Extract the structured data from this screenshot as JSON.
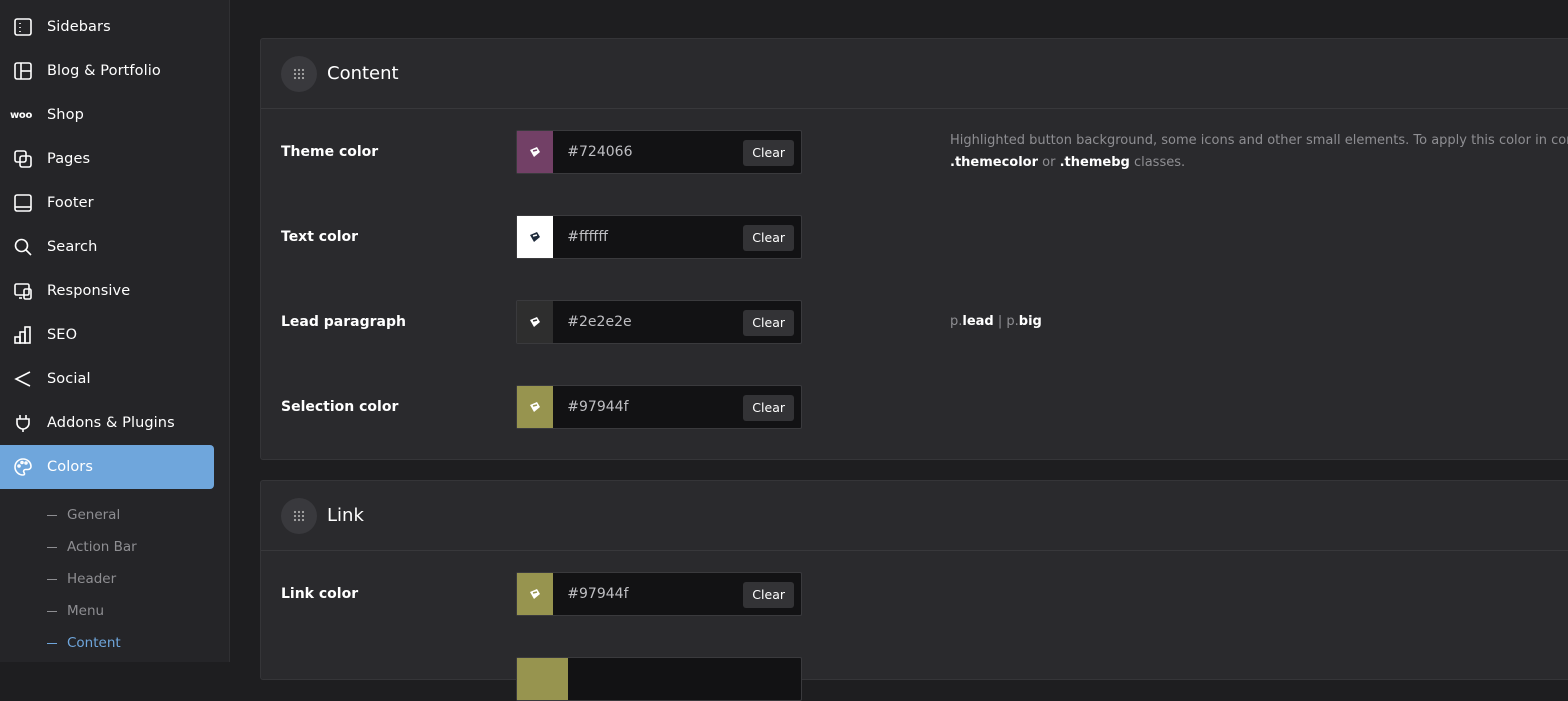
{
  "sidebar": {
    "items": [
      {
        "label": "Sidebars",
        "icon": "sidebar-layout-icon"
      },
      {
        "label": "Blog & Portfolio",
        "icon": "grid-layout-icon"
      },
      {
        "label": "Shop",
        "icon": "woo-icon",
        "icon_text": "woo"
      },
      {
        "label": "Pages",
        "icon": "pages-icon"
      },
      {
        "label": "Footer",
        "icon": "footer-icon"
      },
      {
        "label": "Search",
        "icon": "search-icon"
      },
      {
        "label": "Responsive",
        "icon": "responsive-icon"
      },
      {
        "label": "SEO",
        "icon": "bar-chart-icon"
      },
      {
        "label": "Social",
        "icon": "share-icon"
      },
      {
        "label": "Addons & Plugins",
        "icon": "plug-icon"
      },
      {
        "label": "Colors",
        "icon": "palette-icon",
        "active": true
      }
    ],
    "sub_items": [
      {
        "label": "General"
      },
      {
        "label": "Action Bar"
      },
      {
        "label": "Header"
      },
      {
        "label": "Menu"
      },
      {
        "label": "Content",
        "active": true
      }
    ]
  },
  "content_panel": {
    "title": "Content",
    "rows": [
      {
        "label": "Theme color",
        "value": "#724066",
        "swatch": "#724066",
        "clear": "Clear"
      },
      {
        "label": "Text color",
        "value": "#ffffff",
        "swatch": "#ffffff",
        "clear": "Clear"
      },
      {
        "label": "Lead paragraph",
        "value": "#2e2e2e",
        "swatch": "#2e2e2e",
        "clear": "Clear"
      },
      {
        "label": "Selection color",
        "value": "#97944f",
        "swatch": "#97944f",
        "clear": "Clear"
      }
    ],
    "theme_desc": {
      "line1": "Highlighted button background, some icons and other small elements. To apply this color in cor",
      "class1": ".themecolor",
      "or": " or ",
      "class2": ".themebg",
      "classes": " classes."
    },
    "lead_desc": {
      "p1": "p.",
      "lead": "lead",
      "sep": " | ",
      "p2": "p.",
      "big": "big"
    }
  },
  "link_panel": {
    "title": "Link",
    "rows": [
      {
        "label": "Link color",
        "value": "#97944f",
        "swatch": "#97944f",
        "clear": "Clear"
      },
      {
        "label": "",
        "value": "",
        "swatch": "#97944f",
        "clear": ""
      }
    ]
  },
  "colors": {
    "accent": "#6fa6dc",
    "background": "#1e1e20",
    "panel": "#2a2a2d"
  }
}
